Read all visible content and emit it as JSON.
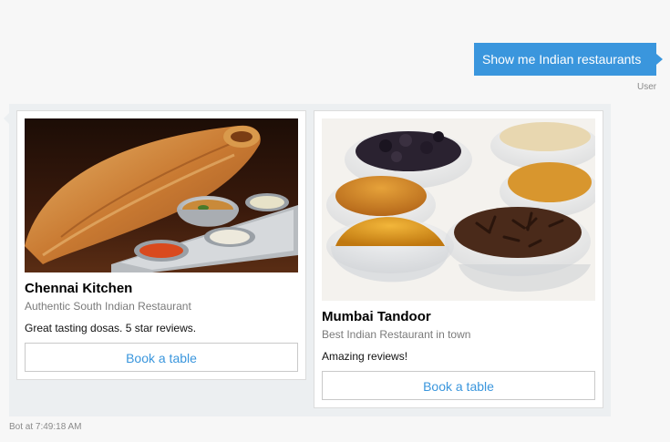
{
  "user_message": {
    "text": "Show me Indian restaurants",
    "sender_label": "User"
  },
  "bot_message": {
    "meta": "Bot at 7:49:18 AM",
    "cards": [
      {
        "title": "Chennai Kitchen",
        "subtitle": "Authentic South Indian Restaurant",
        "text": "Great tasting dosas. 5 star reviews.",
        "button_label": "Book a table",
        "image_subject": "dosa with chutney and sambar on steel tray"
      },
      {
        "title": "Mumbai Tandoor",
        "subtitle": "Best Indian Restaurant in town",
        "text": "Amazing reviews!",
        "button_label": "Book a table",
        "image_subject": "bowls of Indian spices"
      }
    ]
  },
  "colors": {
    "accent": "#3a96dd",
    "panel": "#eceff1",
    "background": "#f7f7f7"
  }
}
